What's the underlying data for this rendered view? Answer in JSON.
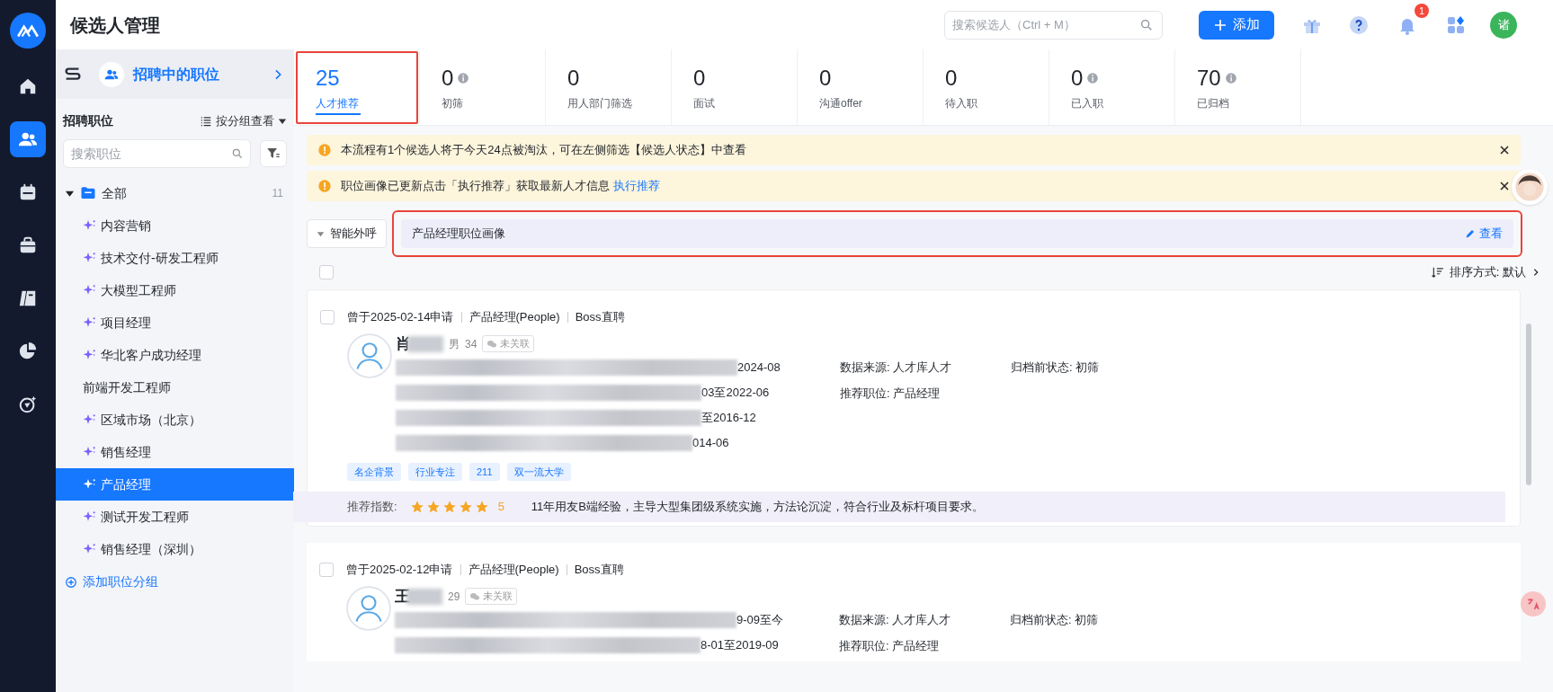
{
  "header": {
    "title": "候选人管理",
    "search": {
      "placeholder": "搜索候选人（Ctrl + M）"
    },
    "add_button": "添加",
    "notifications": "1",
    "avatar": "诸"
  },
  "nav": [
    {
      "selected": false
    },
    {
      "selected": true
    },
    {
      "selected": false
    },
    {
      "selected": false
    },
    {
      "selected": false
    },
    {
      "selected": false
    },
    {
      "selected": false
    }
  ],
  "sidebar": {
    "header": "招聘中的职位",
    "section_title": "招聘职位",
    "view_toggle": "按分组查看",
    "search": {
      "placeholder": "搜索职位"
    },
    "tree": {
      "label": "全部",
      "count": "11",
      "expanded": true,
      "children": [
        {
          "label": "内容营销",
          "ai": true,
          "selected": false
        },
        {
          "label": "技术交付-研发工程师",
          "ai": true,
          "selected": false
        },
        {
          "label": "大模型工程师",
          "ai": true,
          "selected": false
        },
        {
          "label": "项目经理",
          "ai": true,
          "selected": false
        },
        {
          "label": "华北客户成功经理",
          "ai": true,
          "selected": false
        },
        {
          "label": "前端开发工程师",
          "ai": false,
          "selected": false
        },
        {
          "label": "区域市场（北京）",
          "ai": true,
          "selected": false
        },
        {
          "label": "销售经理",
          "ai": true,
          "selected": false
        },
        {
          "label": "产品经理",
          "ai": true,
          "selected": true
        },
        {
          "label": "测试开发工程师",
          "ai": true,
          "selected": false
        },
        {
          "label": "销售经理（深圳）",
          "ai": true,
          "selected": false
        }
      ]
    },
    "add_group": "添加职位分组"
  },
  "stages": [
    {
      "count": "25",
      "label": "人才推荐",
      "info": false,
      "selected": true,
      "highlighted": true
    },
    {
      "count": "0",
      "label": "初筛",
      "info": true,
      "selected": false,
      "highlighted": false
    },
    {
      "count": "0",
      "label": "用人部门筛选",
      "info": false,
      "selected": false,
      "highlighted": false
    },
    {
      "count": "0",
      "label": "面试",
      "info": false,
      "selected": false,
      "highlighted": false
    },
    {
      "count": "0",
      "label": "沟通offer",
      "info": false,
      "selected": false,
      "highlighted": false
    },
    {
      "count": "0",
      "label": "待入职",
      "info": false,
      "selected": false,
      "highlighted": false
    },
    {
      "count": "0",
      "label": "已入职",
      "info": true,
      "selected": false,
      "highlighted": false
    },
    {
      "count": "70",
      "label": "已归档",
      "info": true,
      "selected": false,
      "highlighted": false
    }
  ],
  "alerts": [
    {
      "text": "本流程有1个候选人将于今天24点被淘汰，可在左侧筛选【候选人状态】中查看"
    },
    {
      "text": "职位画像已更新点击「执行推荐」获取最新人才信息",
      "link": "执行推荐"
    }
  ],
  "toolbar": {
    "select_all_checked": false,
    "smart_call": "智能外呼",
    "profile": {
      "title": "产品经理职位画像",
      "action": "查看",
      "highlighted": true
    },
    "sort": "排序方式: 默认"
  },
  "candidates": [
    {
      "checked": false,
      "applied": "曾于2025-02-14申请",
      "position": "产品经理(People)",
      "source": "Boss直聘",
      "name": "肖",
      "gender": "男",
      "age": "34",
      "wechat": "未关联",
      "experience": [
        "2024-08",
        "03至2022-06",
        "至2016-12",
        "014-06"
      ],
      "data_source": "数据来源: 人才库人才",
      "recommended_position": "推荐职位: 产品经理",
      "archived_status": "归档前状态: 初筛",
      "tags": [
        "名企背景",
        "行业专注",
        "211",
        "双一流大学"
      ],
      "score_label": "推荐指数:",
      "stars": 5,
      "score": "5",
      "summary": "11年用友B端经验，主导大型集团级系统实施，方法论沉淀，符合行业及标杆项目要求。"
    },
    {
      "checked": false,
      "applied": "曾于2025-02-12申请",
      "position": "产品经理(People)",
      "source": "Boss直聘",
      "name": "王",
      "age": "29",
      "wechat": "未关联",
      "experience": [
        "9-09至今",
        "8-01至2019-09"
      ],
      "data_source": "数据来源: 人才库人才",
      "recommended_position": "推荐职位: 产品经理",
      "archived_status": "归档前状态: 初筛"
    }
  ]
}
